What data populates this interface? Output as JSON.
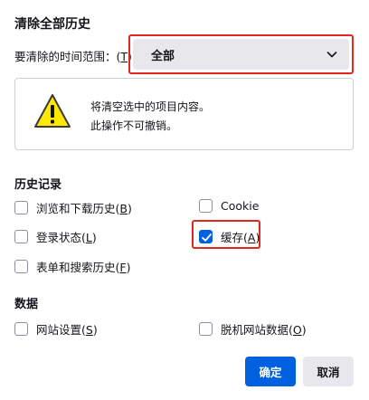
{
  "dialog": {
    "title": "清除全部历史",
    "range_label": "要清除的时间范围：",
    "range_accesskey": "T",
    "range_value": "全部",
    "warning": {
      "line1": "将清空选中的项目内容。",
      "line2": "此操作不可撤销。"
    },
    "history_section": "历史记录",
    "history_items": [
      {
        "label": "浏览和下载历史",
        "key": "B",
        "checked": false
      },
      {
        "label": "Cookie",
        "key": "C",
        "checked": false
      },
      {
        "label": "登录状态",
        "key": "L",
        "checked": false
      },
      {
        "label": "缓存",
        "key": "A",
        "checked": true
      },
      {
        "label": "表单和搜索历史",
        "key": "F",
        "checked": false
      }
    ],
    "data_section": "数据",
    "data_items": [
      {
        "label": "网站设置",
        "key": "S",
        "checked": false
      },
      {
        "label": "脱机网站数据",
        "key": "O",
        "checked": false
      }
    ],
    "ok_label": "确定",
    "cancel_label": "取消"
  },
  "colors": {
    "accent": "#0061e0",
    "highlight": "#e0281f",
    "warning_yellow": "#ffe900"
  }
}
